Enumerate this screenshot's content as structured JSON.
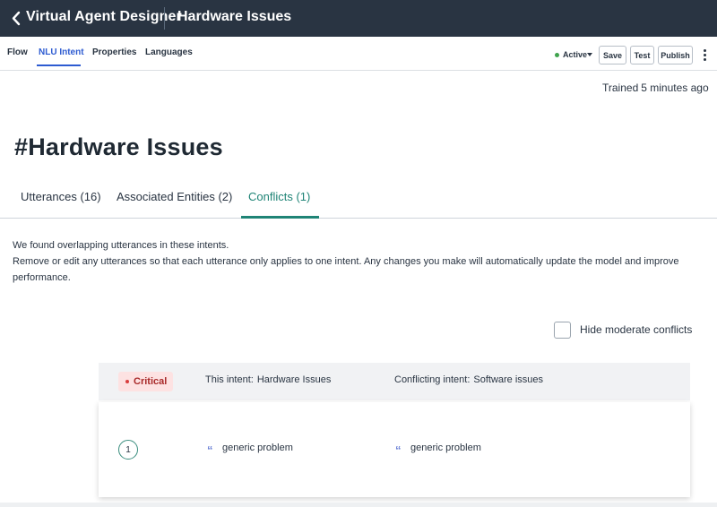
{
  "topbar": {
    "app_title": "Virtual Agent Designer",
    "doc_title": "Hardware Issues"
  },
  "subnav": {
    "tabs": [
      {
        "label": "Flow"
      },
      {
        "label": "NLU Intent",
        "active": true
      },
      {
        "label": "Properties"
      },
      {
        "label": "Languages"
      }
    ],
    "status": "Active",
    "buttons": {
      "save": "Save",
      "test": "Test",
      "publish": "Publish"
    }
  },
  "trained": {
    "label": "Trained",
    "time": "5 minutes ago"
  },
  "intent_heading": "#Hardware Issues",
  "tabs": [
    {
      "label": "Utterances (16)"
    },
    {
      "label": "Associated Entities (2)"
    },
    {
      "label": "Conflicts (1)",
      "active": true
    }
  ],
  "info": {
    "line1": "We found overlapping utterances in these intents.",
    "line2": "Remove or edit any utterances so that each utterance only applies to one intent. Any changes you make will automatically update the model and improve performance."
  },
  "hide_moderate": {
    "label": "Hide moderate conflicts",
    "checked": false
  },
  "conflict": {
    "severity": "Critical",
    "this_intent_label": "This intent:",
    "this_intent_value": "Hardware Issues",
    "conflicting_label": "Conflicting intent:",
    "conflicting_value": "Software issues",
    "rows": [
      {
        "number": "1",
        "this_utterance": "generic problem",
        "conflicting_utterance": "generic problem"
      }
    ]
  },
  "colors": {
    "topbar": "#293442",
    "nav_active": "#2d5bd1",
    "tab_active": "#1f8476",
    "critical_bg": "#fde2e2",
    "critical_text": "#a82929",
    "status_dot": "#3fa34d"
  },
  "icons": {
    "back": "chevron-left-icon",
    "status": "status-dot-icon",
    "dropdown": "caret-down-icon",
    "more": "kebab-icon",
    "quote": "quote-icon"
  }
}
